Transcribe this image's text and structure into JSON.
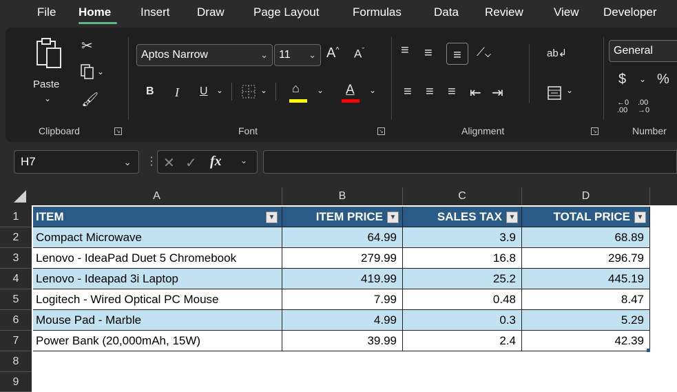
{
  "tabs": [
    {
      "label": "File"
    },
    {
      "label": "Home"
    },
    {
      "label": "Insert"
    },
    {
      "label": "Draw"
    },
    {
      "label": "Page Layout"
    },
    {
      "label": "Formulas"
    },
    {
      "label": "Data"
    },
    {
      "label": "Review"
    },
    {
      "label": "View"
    },
    {
      "label": "Developer"
    }
  ],
  "ribbon": {
    "paste_label": "Paste",
    "font_name": "Aptos Narrow",
    "font_size": "11",
    "bold": "B",
    "italic": "I",
    "underline": "U",
    "font_color_letter": "A",
    "number_format": "General",
    "currency": "$",
    "percent": "%",
    "groups": {
      "clipboard": "Clipboard",
      "font": "Font",
      "alignment": "Alignment",
      "number": "Number"
    },
    "colors": {
      "highlight": "#ffff00",
      "font_color": "#ff0000"
    }
  },
  "formula_bar": {
    "name_box": "H7",
    "fx": "fx",
    "formula": ""
  },
  "sheet": {
    "columns": [
      "A",
      "B",
      "C",
      "D"
    ],
    "rows": [
      "1",
      "2",
      "3",
      "4",
      "5",
      "6",
      "7",
      "8",
      "9"
    ],
    "headers": [
      "ITEM",
      "ITEM PRICE",
      "SALES TAX",
      "TOTAL PRICE"
    ],
    "data": [
      [
        "Compact Microwave",
        "64.99",
        "3.9",
        "68.89"
      ],
      [
        "Lenovo - IdeaPad Duet 5 Chromebook",
        "279.99",
        "16.8",
        "296.79"
      ],
      [
        "Lenovo - Ideapad 3i Laptop",
        "419.99",
        "25.2",
        "445.19"
      ],
      [
        "Logitech - Wired Optical PC Mouse",
        "7.99",
        "0.48",
        "8.47"
      ],
      [
        "Mouse Pad - Marble",
        "4.99",
        "0.3",
        "5.29"
      ],
      [
        "Power Bank (20,000mAh, 15W)",
        "39.99",
        "2.4",
        "42.39"
      ]
    ],
    "colors": {
      "header_bg": "#2a5a86",
      "band_bg": "#c2e1f1"
    }
  }
}
